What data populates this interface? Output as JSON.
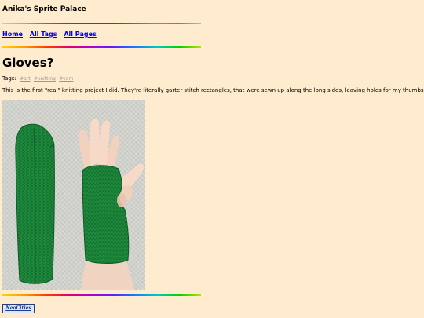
{
  "site": {
    "title": "Anika's Sprite Palace"
  },
  "nav": {
    "items": [
      {
        "label": "Home"
      },
      {
        "label": "All Tags"
      },
      {
        "label": "All Pages"
      }
    ]
  },
  "post": {
    "title": "Gloves?",
    "tags_label": "Tags:",
    "tags": [
      "#art",
      "#knitting",
      "#yarn"
    ],
    "body": "This is the first \"real\" knitting project I did. They're literally garter stitch rectangles, that were sewn up along the long sides, leaving holes for my thumbs."
  },
  "footer": {
    "badge_text": "NeoCities"
  },
  "colors": {
    "background": "#ffebcd",
    "link": "#0000ee",
    "tag": "#999999",
    "knit_green": "#1e8a3e"
  }
}
